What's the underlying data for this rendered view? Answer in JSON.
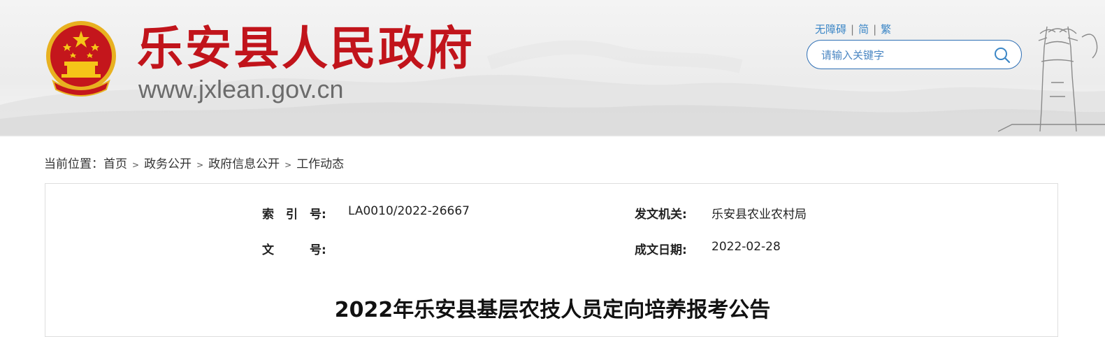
{
  "header": {
    "site_title": "乐安县人民政府",
    "site_url": "www.jxlean.gov.cn",
    "toplinks": [
      "无障碍",
      "简",
      "繁"
    ],
    "search_placeholder": "请输入关键字"
  },
  "breadcrumb": {
    "prefix": "当前位置：",
    "items": [
      "首页",
      "政务公开",
      "政府信息公开",
      "工作动态"
    ]
  },
  "meta": {
    "index_label": "索　引　号:",
    "index_value": "LA0010/2022-26667",
    "issuer_label": "发文机关:",
    "issuer_value": "乐安县农业农村局",
    "doc_no_label": "文　　　号:",
    "doc_no_value": "",
    "date_label": "成文日期:",
    "date_value": "2022-02-28"
  },
  "article": {
    "title": "2022年乐安县基层农技人员定向培养报考公告"
  },
  "colors": {
    "title_red": "#c1141b",
    "link_blue": "#3b86c6",
    "search_border": "#2e6fb5"
  }
}
